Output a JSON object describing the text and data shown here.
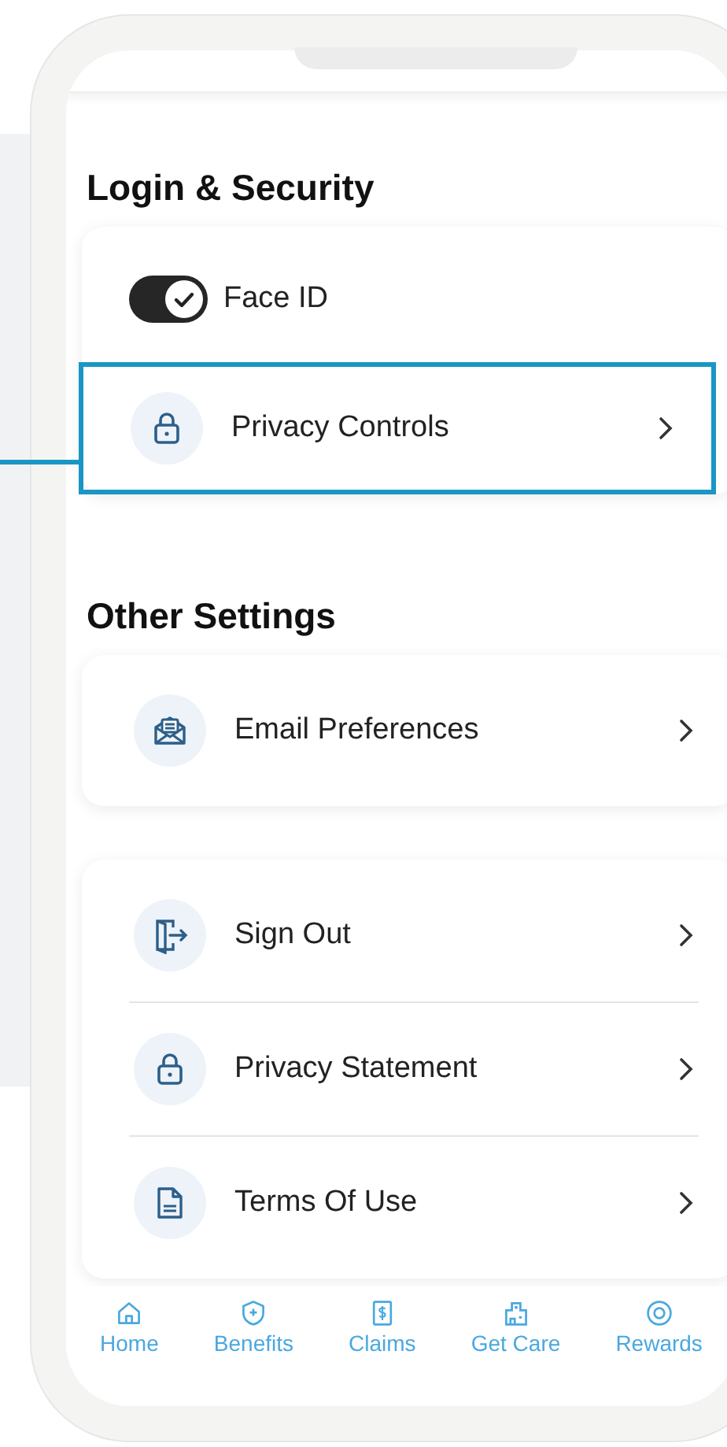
{
  "login_security": {
    "title": "Login & Security",
    "face_id": {
      "label": "Face ID",
      "checked": true
    },
    "items": [
      {
        "label": "Privacy Controls",
        "kind": "lock",
        "highlighted": true
      }
    ]
  },
  "other_settings": {
    "title": "Other Settings",
    "groups": [
      {
        "items": [
          {
            "label": "Email Preferences",
            "kind": "mail",
            "highlighted": false
          }
        ]
      },
      {
        "items": [
          {
            "label": "Sign Out",
            "kind": "signout",
            "highlighted": false
          },
          {
            "label": "Privacy Statement",
            "kind": "lock",
            "highlighted": false
          },
          {
            "label": "Terms Of Use",
            "kind": "doc",
            "highlighted": false
          }
        ]
      }
    ]
  },
  "bottom_nav": [
    {
      "label": "Home",
      "kind": "home",
      "selected": false
    },
    {
      "label": "Benefits",
      "kind": "shield",
      "selected": false
    },
    {
      "label": "Claims",
      "kind": "claims",
      "selected": false
    },
    {
      "label": "Get Care",
      "kind": "care",
      "selected": false
    },
    {
      "label": "Rewards",
      "kind": "rewards",
      "selected": false
    }
  ]
}
